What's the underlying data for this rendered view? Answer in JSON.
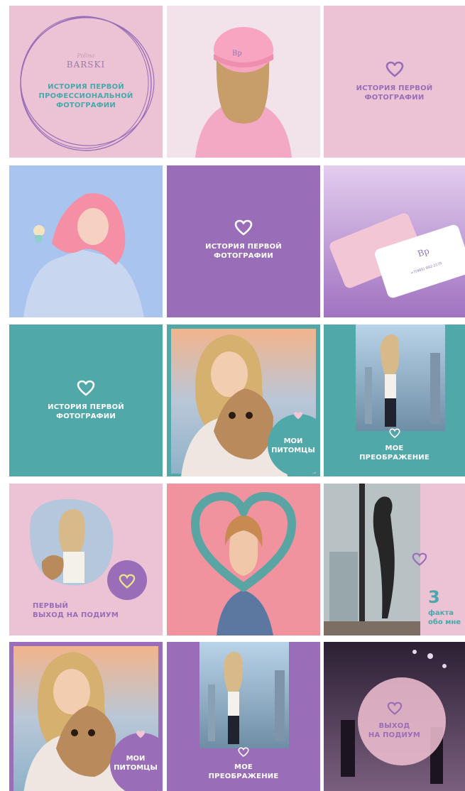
{
  "colors": {
    "pink": "#ecc3d4",
    "purple": "#9a6db8",
    "teal": "#50a8a9",
    "text_teal": "#47a9ab",
    "text_purple": "#9a6db8",
    "white": "#ffffff"
  },
  "tiles": [
    {
      "name": "logo-tile",
      "logo_script": "Polina",
      "logo_brand": "BARSKI",
      "caption": "ИСТОРИЯ ПЕРВОЙ\nПРОФЕССИОНАЛЬНОЙ\nФОТОГРАФИИ"
    },
    {
      "name": "cap-photo-tile",
      "icon": "pink-cap-photo"
    },
    {
      "name": "pink-caption-tile",
      "icon": "heart-icon",
      "caption": "ИСТОРИЯ ПЕРВОЙ\nФОТОГРАФИИ"
    },
    {
      "name": "pink-wig-photo-tile",
      "icon": "portrait-photo"
    },
    {
      "name": "purple-caption-tile",
      "icon": "heart-icon",
      "caption": "ИСТОРИЯ ПЕРВОЙ\nФОТОГРАФИИ"
    },
    {
      "name": "business-cards-tile",
      "card_logo": "Bp",
      "card_phone": "+7(985) 992-2175"
    },
    {
      "name": "teal-caption-tile",
      "icon": "heart-icon",
      "caption": "ИСТОРИЯ ПЕРВОЙ\nФОТОГРАФИИ"
    },
    {
      "name": "pets-teal-tile",
      "icon": "heart-icon",
      "caption": "МОИ\nПИТОМЦЫ"
    },
    {
      "name": "transformation-teal-tile",
      "icon": "heart-icon",
      "caption": "МОЕ\nПРЕОБРАЖЕНИЕ"
    },
    {
      "name": "runway-pink-tile",
      "icon": "heart-icon",
      "caption": "ПЕРВЫЙ\nВЫХОД НА ПОДИУМ"
    },
    {
      "name": "heart-frame-tile",
      "icon": "heart-frame-photo"
    },
    {
      "name": "facts-tile",
      "icon": "heart-icon",
      "fact_number": "3",
      "fact_text": "факта\nобо мне"
    },
    {
      "name": "pets-purple-tile",
      "icon": "heart-icon",
      "caption": "МОИ\nПИТОМЦЫ"
    },
    {
      "name": "transformation-purple-tile",
      "icon": "heart-icon",
      "caption": "МОЕ\nПРЕОБРАЖЕНИЕ"
    },
    {
      "name": "runway-exit-tile",
      "icon": "heart-icon",
      "caption": "ВЫХОД\nНА ПОДИУМ"
    }
  ]
}
